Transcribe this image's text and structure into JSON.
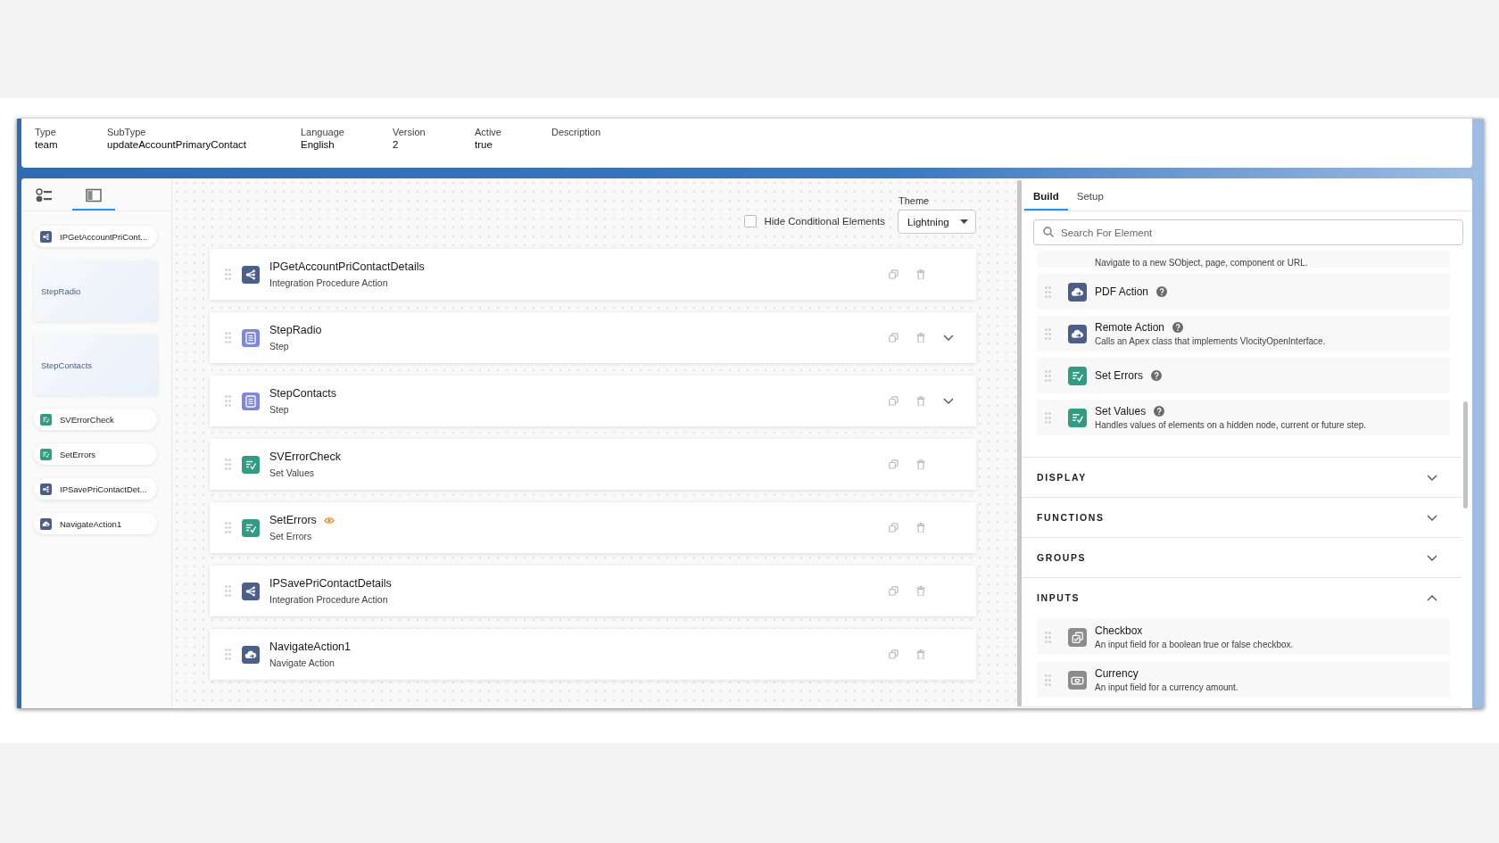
{
  "header": {
    "fields": [
      {
        "label": "Type",
        "value": "team"
      },
      {
        "label": "SubType",
        "value": "updateAccountPrimaryContact"
      },
      {
        "label": "Language",
        "value": "English"
      },
      {
        "label": "Version",
        "value": "2"
      },
      {
        "label": "Active",
        "value": "true"
      },
      {
        "label": "Description"
      }
    ]
  },
  "sidebar": {
    "view_tabs": [
      {
        "kind": "outline",
        "selected": false
      },
      {
        "kind": "panel",
        "selected": true
      }
    ],
    "items": [
      {
        "kind": "integration",
        "label": "IPGetAccountPriCont..."
      },
      {
        "kind": "step",
        "label": "StepRadio"
      },
      {
        "kind": "step",
        "label": "StepContacts"
      },
      {
        "kind": "setvalues",
        "label": "SVErrorCheck"
      },
      {
        "kind": "setvalues",
        "label": "SetErrors"
      },
      {
        "kind": "integration",
        "label": "IPSavePriContactDet..."
      },
      {
        "kind": "navigate",
        "label": "NavigateAction1"
      }
    ]
  },
  "canvas": {
    "hide_conditional": {
      "label": "Hide Conditional Elements",
      "checked": false
    },
    "theme": {
      "label": "Theme",
      "value": "Lightning"
    },
    "elements": [
      {
        "name": "IPGetAccountPriContactDetails",
        "type": "Integration Procedure Action",
        "kind": "integration",
        "conditional": false
      },
      {
        "name": "StepRadio",
        "type": "Step",
        "kind": "step",
        "conditional": false,
        "expanded": false
      },
      {
        "name": "StepContacts",
        "type": "Step",
        "kind": "step",
        "conditional": false,
        "expanded": false
      },
      {
        "name": "SVErrorCheck",
        "type": "Set Values",
        "kind": "setvalues",
        "conditional": false
      },
      {
        "name": "SetErrors",
        "type": "Set Errors",
        "kind": "setvalues",
        "conditional": true
      },
      {
        "name": "IPSavePriContactDetails",
        "type": "Integration Procedure Action",
        "kind": "integration",
        "conditional": false
      },
      {
        "name": "NavigateAction1",
        "type": "Navigate Action",
        "kind": "navigate",
        "conditional": false
      }
    ]
  },
  "panel": {
    "tabs": [
      {
        "label": "Build",
        "selected": true
      },
      {
        "label": "Setup",
        "selected": false
      }
    ],
    "search": {
      "placeholder": "Search For Element"
    },
    "palette": [
      {
        "kind": "cut",
        "description": "Navigate to a new SObject, page, component or URL."
      },
      {
        "kind": "navigate",
        "name": "PDF Action",
        "help": true
      },
      {
        "kind": "navigate",
        "name": "Remote Action",
        "description": "Calls an Apex class that implements VlocityOpenInterface.",
        "help": true
      },
      {
        "kind": "setvalues",
        "name": "Set Errors",
        "help": true
      },
      {
        "kind": "setvalues",
        "name": "Set Values",
        "description": "Handles values of elements on a hidden node, current or future step.",
        "help": true
      }
    ],
    "sections": [
      {
        "title": "DISPLAY",
        "expanded": false
      },
      {
        "title": "FUNCTIONS",
        "expanded": false
      },
      {
        "title": "GROUPS",
        "expanded": false
      },
      {
        "title": "INPUTS",
        "expanded": true,
        "items": [
          {
            "kind": "checkbox",
            "name": "Checkbox",
            "description": "An input field for a boolean true or false checkbox.",
            "help": false
          },
          {
            "kind": "currency",
            "name": "Currency",
            "description": "An input field for a currency amount.",
            "help": false
          }
        ]
      }
    ]
  }
}
